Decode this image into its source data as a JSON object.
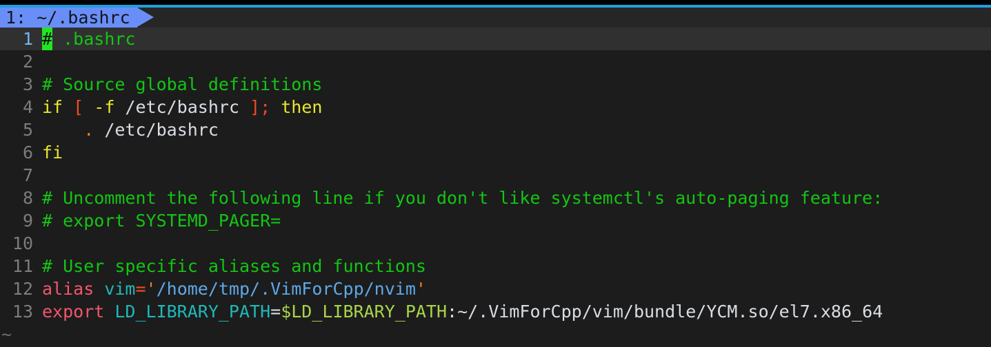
{
  "window": {
    "title": "vim",
    "background_color": "#1c1c1c",
    "accent_color": "#1f9ede"
  },
  "tabline": {
    "tabs": [
      {
        "index": "1",
        "label": "1: ~/.bashrc",
        "active": true,
        "bg_color": "#6a8ef7",
        "fg_color": "#12151c"
      }
    ]
  },
  "editor": {
    "filename": "~/.bashrc",
    "cursor_line": 1,
    "cursor_column": 1,
    "cursor_color": "#22e522",
    "cursorline_bg": "#303030",
    "line_number_color": "#7c7c7c",
    "current_line_number_color": "#74b5f0",
    "filler_char": "~",
    "lines": [
      {
        "number": "1",
        "text": "# .bashrc",
        "tokens": [
          {
            "text": "#",
            "style": "cursor"
          },
          {
            "text": " .bashrc",
            "style": "comment"
          }
        ]
      },
      {
        "number": "2",
        "text": "",
        "tokens": []
      },
      {
        "number": "3",
        "text": "# Source global definitions",
        "tokens": [
          {
            "text": "# Source global definitions",
            "style": "comment"
          }
        ]
      },
      {
        "number": "4",
        "text": "if [ -f /etc/bashrc ]; then",
        "tokens": [
          {
            "text": "if ",
            "style": "keyword"
          },
          {
            "text": "[ ",
            "style": "operator"
          },
          {
            "text": "-f",
            "style": "keyword"
          },
          {
            "text": " /etc/bashrc ",
            "style": "path"
          },
          {
            "text": "];",
            "style": "operator"
          },
          {
            "text": " then",
            "style": "keyword"
          }
        ]
      },
      {
        "number": "5",
        "text": "    . /etc/bashrc",
        "tokens": [
          {
            "text": "    ",
            "style": "plain"
          },
          {
            "text": ".",
            "style": "dot"
          },
          {
            "text": " /etc/bashrc",
            "style": "path"
          }
        ]
      },
      {
        "number": "6",
        "text": "fi",
        "tokens": [
          {
            "text": "fi",
            "style": "keyword"
          }
        ]
      },
      {
        "number": "7",
        "text": "",
        "tokens": []
      },
      {
        "number": "8",
        "text": "# Uncomment the following line if you don't like systemctl's auto-paging feature:",
        "tokens": [
          {
            "text": "# Uncomment the following line if you don't like systemctl's auto-paging feature:",
            "style": "comment"
          }
        ]
      },
      {
        "number": "9",
        "text": "# export SYSTEMD_PAGER=",
        "tokens": [
          {
            "text": "# export SYSTEMD_PAGER=",
            "style": "comment"
          }
        ]
      },
      {
        "number": "10",
        "text": "",
        "tokens": []
      },
      {
        "number": "11",
        "text": "# User specific aliases and functions",
        "tokens": [
          {
            "text": "# User specific aliases and functions",
            "style": "comment"
          }
        ]
      },
      {
        "number": "12",
        "text": "alias vim='/home/tmp/.VimForCpp/nvim'",
        "tokens": [
          {
            "text": "alias ",
            "style": "cmd"
          },
          {
            "text": "vim",
            "style": "var"
          },
          {
            "text": "=",
            "style": "eq"
          },
          {
            "text": "'",
            "style": "quote"
          },
          {
            "text": "/home/tmp/.VimForCpp/nvim",
            "style": "string"
          },
          {
            "text": "'",
            "style": "quote"
          }
        ]
      },
      {
        "number": "13",
        "text": "export LD_LIBRARY_PATH=$LD_LIBRARY_PATH:~/.VimForCpp/vim/bundle/YCM.so/el7.x86_64",
        "tokens": [
          {
            "text": "export ",
            "style": "cmd"
          },
          {
            "text": "LD_LIBRARY_PATH",
            "style": "var"
          },
          {
            "text": "=",
            "style": "eqwhite"
          },
          {
            "text": "$LD_LIBRARY_PATH",
            "style": "shellvar"
          },
          {
            "text": ":~/.VimForCpp/vim/bundle/YCM.so/el7.x86_64",
            "style": "path"
          }
        ]
      }
    ]
  }
}
